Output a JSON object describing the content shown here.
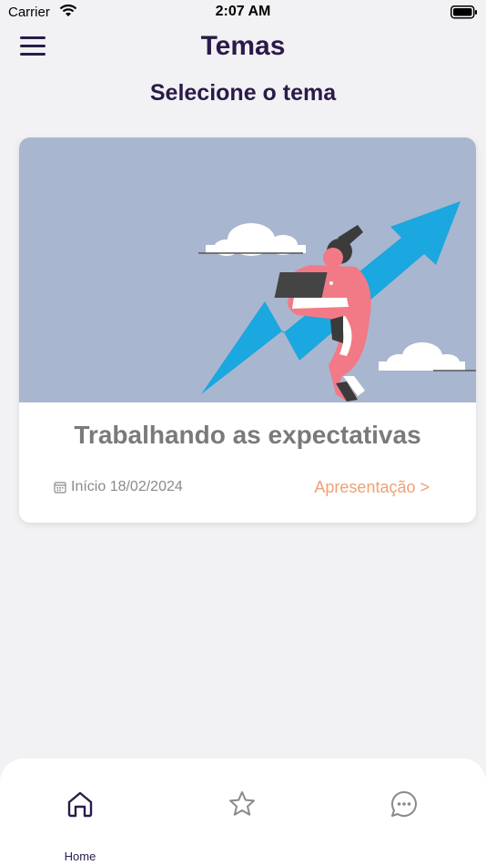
{
  "status_bar": {
    "carrier": "Carrier",
    "time": "2:07 AM"
  },
  "header": {
    "title": "Temas",
    "menu_icon": "hamburger-menu-icon"
  },
  "section": {
    "title": "Selecione o tema"
  },
  "theme_card": {
    "title": "Trabalhando as expectativas",
    "date_label": "Início 18/02/2024",
    "link_label": "Apresentação >",
    "image_background": "#a9b6cf",
    "link_color": "#f0a074"
  },
  "bottom_nav": {
    "tabs": [
      {
        "icon": "home-icon",
        "label": "Home",
        "active": true
      },
      {
        "icon": "star-icon",
        "label": "",
        "active": false
      },
      {
        "icon": "chat-bubble-icon",
        "label": "",
        "active": false
      }
    ]
  },
  "colors": {
    "primary": "#2a1b4a",
    "background": "#f2f2f4",
    "accent_orange": "#f0a074",
    "inactive_icon": "#8a8a8a"
  }
}
